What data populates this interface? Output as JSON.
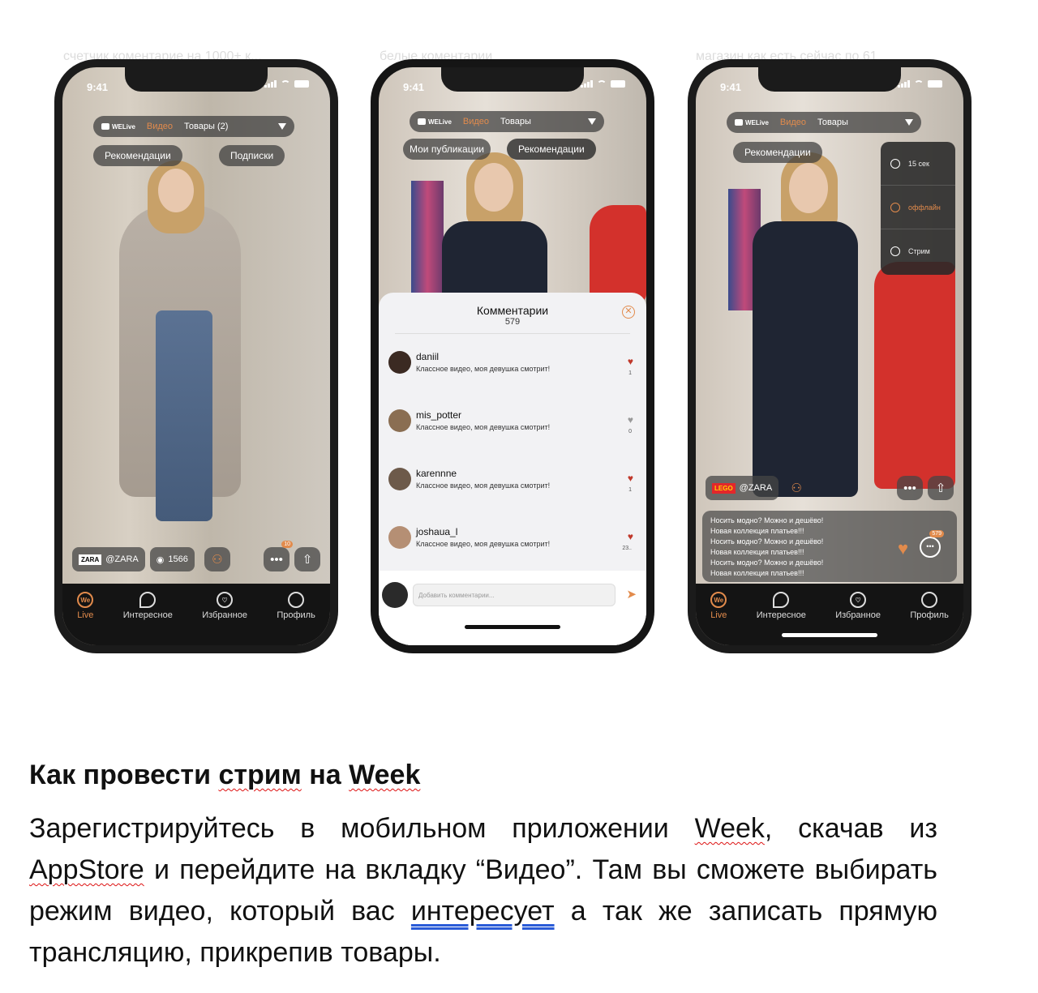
{
  "captions": {
    "c1": "счетчик коментарие на 1000+ к...",
    "c2": "белые коментарии",
    "c3": "магазин как есть сейчас по 61"
  },
  "status": {
    "time": "9:41"
  },
  "top_bar": {
    "logo": "WELive",
    "video": "Видео",
    "goods_counted": "Товары (2)",
    "goods": "Товары"
  },
  "phone1": {
    "tab_recommend": "Рекомендации",
    "tab_subs": "Подписки",
    "brand_logo": "ZARA",
    "brand": "@ZARA",
    "views": "1566",
    "badge": "10"
  },
  "phone2": {
    "tab_my": "Мои публикации",
    "tab_recommend": "Рекомендации",
    "comments_title": "Комментарии",
    "comments_count": "579",
    "items": [
      {
        "name": "daniil",
        "text": "Классное видео, моя девушка смотрит!",
        "likes": "1"
      },
      {
        "name": "mis_potter",
        "text": "Классное видео, моя девушка смотрит!",
        "likes": "0"
      },
      {
        "name": "karennne",
        "text": "Классное видео, моя девушка смотрит!",
        "likes": "1"
      },
      {
        "name": "joshaua_l",
        "text": "Классное видео, моя девушка смотрит!",
        "likes": "23.."
      }
    ],
    "input_placeholder": "Добавить комментарии..."
  },
  "phone3": {
    "tab_recommend": "Рекомендации",
    "menu": [
      "15 сек",
      "оффлайн",
      "Стрим"
    ],
    "brand_logo": "LEGO",
    "brand": "@ZARA",
    "chat": [
      "Носить модно? Можно и дешёво!",
      "Новая коллекция платьев!!!",
      "Носить модно? Можно и дешёво!",
      "Новая коллекция платьев!!!",
      "Носить модно? Можно и дешёво!",
      "Новая коллекция платьев!!!"
    ],
    "chat_badge": "579"
  },
  "nav": {
    "live_icon": "We",
    "live": "Live",
    "interesting": "Интересное",
    "favorites": "Избранное",
    "profile": "Профиль"
  },
  "text": {
    "heading_a": "Как провести ",
    "heading_b": "стрим",
    "heading_c": " на ",
    "heading_d": "Week",
    "p1": "Зарегистрируйтесь в мобильном приложении ",
    "p2": "Week",
    "p3": ", скачав из ",
    "p4": "AppStore",
    "p5": " и перейдите на вкладку “Видео”. Там вы сможете выбирать режим видео, который вас ",
    "p6": "интересует",
    "p7": " а так же записать прямую трансляцию, прикрепив товары."
  },
  "colors": {
    "accent": "#e28b4c",
    "dark": "#1b1b1b",
    "heart": "#c0392b"
  }
}
